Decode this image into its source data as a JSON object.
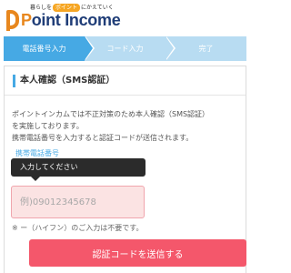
{
  "header": {
    "tagline_before": "暮らしを",
    "tagline_highlight": "ポイント",
    "tagline_after": "にかえていく",
    "logo_first": "P",
    "logo_rest": "oint Income",
    "brand_color": "#e8871e",
    "logo_text_color": "#1f3d77"
  },
  "steps": [
    {
      "label": "電話番号入力",
      "active": true
    },
    {
      "label": "コード入力",
      "active": false
    },
    {
      "label": "完了",
      "active": false
    }
  ],
  "card": {
    "title": "本人確認（SMS認証）",
    "description": [
      "ポイントインカムでは不正対策のため本人確認（SMS認証）",
      "を実施しております。",
      "携帯電話番号を入力すると認証コードが送信されます。"
    ],
    "field_label": "携帯電話番号",
    "tooltip": "入力してください",
    "phone_placeholder": "例)09012345678",
    "note": "※ ー（ハイフン）のご入力は不要です。",
    "submit_label": "認証コードを送信する"
  },
  "colors": {
    "accent_blue": "#46a9e4",
    "step_inactive": "#b8dcf2",
    "submit": "#f4576b",
    "input_error_bg": "#fbe3e3"
  }
}
